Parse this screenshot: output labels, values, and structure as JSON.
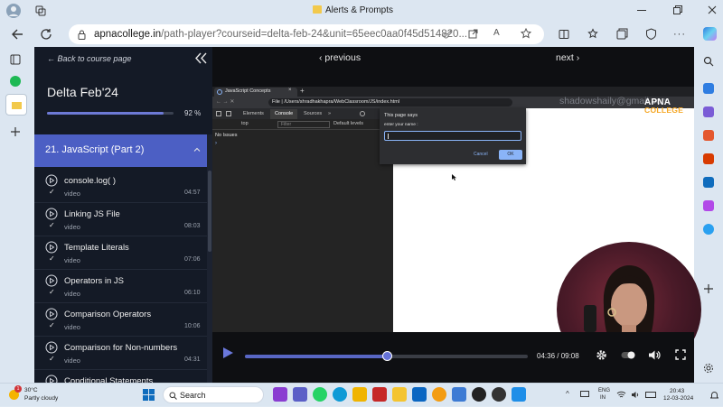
{
  "browser": {
    "window_title": "Alerts & Prompts",
    "url_domain": "apnacollege.in",
    "url_rest": "/path-player?courseid=delta-feb-24&unit=65eec0aa0f45d514820..."
  },
  "sidebar": {
    "back_label": "← Back to course page",
    "course_title": "Delta Feb'24",
    "progress_label": "92 %",
    "progress_fraction": 0.92,
    "section_title": "21. JavaScript (Part 2)",
    "lessons": [
      {
        "title": "console.log( )",
        "type": "video",
        "duration": "04:57",
        "check": "✓"
      },
      {
        "title": "Linking JS File",
        "type": "video",
        "duration": "08:03",
        "check": "✓"
      },
      {
        "title": "Template Literals",
        "type": "video",
        "duration": "07:06",
        "check": "✓"
      },
      {
        "title": "Operators in JS",
        "type": "video",
        "duration": "06:10",
        "check": "✓"
      },
      {
        "title": "Comparison Operators",
        "type": "video",
        "duration": "10:06",
        "check": "✓"
      },
      {
        "title": "Comparison for Non-numbers",
        "type": "video",
        "duration": "04:31",
        "check": "✓"
      },
      {
        "title": "Conditional Statements",
        "type": "video",
        "duration": "",
        "check": ""
      }
    ]
  },
  "player": {
    "prev_label": "‹ previous",
    "next_label": "next ›",
    "time": "04:36 / 09:08",
    "progress_fraction": 0.503,
    "video": {
      "tab_title": "JavaScript Concepts",
      "file_label": "File",
      "url": "/Users/shradhakhapra/WebClassroom/JS/index.html",
      "devtools_tabs": [
        "Elements",
        "Console",
        "Sources"
      ],
      "context": "top",
      "filter_placeholder": "Filter",
      "levels": "Default levels",
      "no_issues": "No Issues",
      "prompt_arrow": "›",
      "dialog_title": "This page says",
      "dialog_message": "enter your name :",
      "dialog_cancel": "Cancel",
      "dialog_ok": "OK",
      "watermark": "shadowshaily@gmail.com",
      "logo_top": "APNA",
      "logo_bottom": "COLLEGE"
    }
  },
  "taskbar": {
    "weather_temp": "30°C",
    "weather_desc": "Partly cloudy",
    "weather_badge": "1",
    "search_label": "Search",
    "lang_1": "ENG",
    "lang_2": "IN",
    "clock_time": "20:43",
    "clock_date": "12-03-2024"
  },
  "colors": {
    "accent": "#4c5fc4",
    "sidebar_bg": "#141a26",
    "player_bg": "#0e0f12"
  }
}
